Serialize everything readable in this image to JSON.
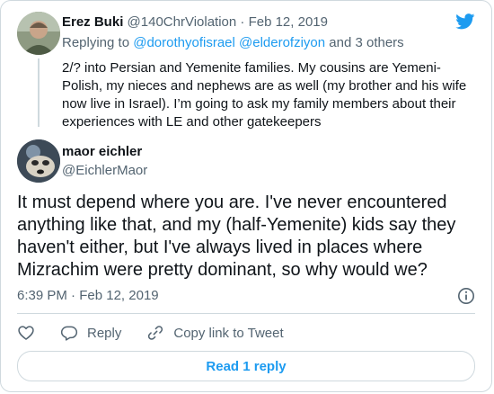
{
  "parent_tweet": {
    "name": "Erez Buki",
    "handle": "@140ChrViolation",
    "separator": " · ",
    "date": "Feb 12, 2019",
    "replying_label": "Replying to ",
    "replying_users": "@dorothyofisrael @elderofziyon",
    "replying_others": " and 3 others",
    "text": "2/? into Persian and Yemenite families. My cousins are Yemeni-Polish, my nieces and nephews are as well (my brother and his wife now live in Israel). I’m going to ask my family members about their experiences with LE and other gatekeepers",
    "avatar_icon": "person-photo-avatar"
  },
  "tweet": {
    "name": "maor eichler",
    "handle": "@EichlerMaor",
    "text": "It must depend where you are. I've never encountered anything like that, and my (half-Yemenite) kids say they haven't either, but I've always lived in places where Mizrachim were pretty dominant, so why would we?",
    "time": "6:39 PM",
    "date_sep": " · ",
    "date": "Feb 12, 2019",
    "avatar_icon": "dog-photo-avatar"
  },
  "actions": {
    "like_icon": "heart-icon",
    "reply_label": "Reply",
    "reply_icon": "speech-bubble-icon",
    "copy_label": "Copy link to Tweet",
    "copy_icon": "link-icon"
  },
  "read_replies_label": "Read 1 reply",
  "brand": {
    "logo": "twitter-bird-icon",
    "accent": "#1d9bf0",
    "muted": "#536471",
    "border": "#cfd9de"
  }
}
